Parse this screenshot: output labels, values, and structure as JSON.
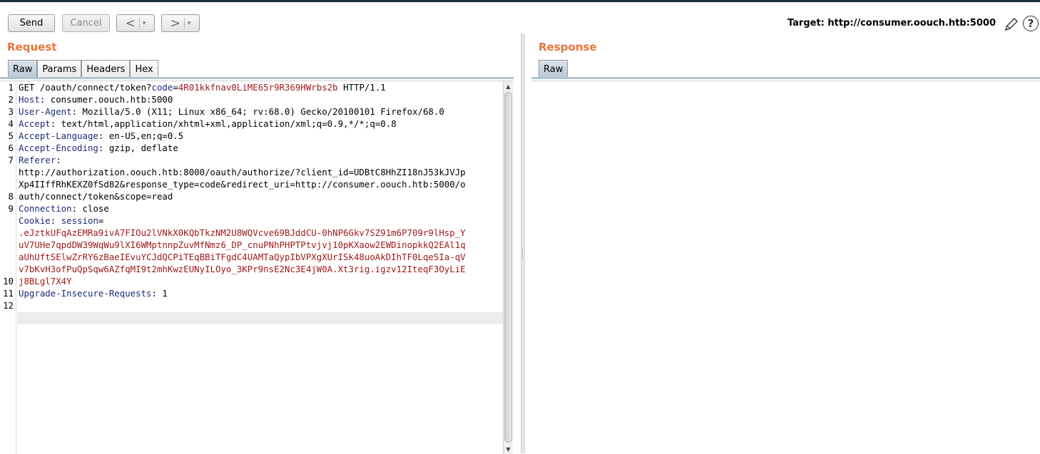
{
  "toolbar": {
    "send_label": "Send",
    "cancel_label": "Cancel",
    "back_glyph": "<",
    "forward_glyph": ">",
    "dropdown_glyph": "▾",
    "target_label": "Target: http://consumer.oouch.htb:5000"
  },
  "request": {
    "title": "Request",
    "tabs": [
      "Raw",
      "Params",
      "Headers",
      "Hex"
    ],
    "active_tab": "Raw",
    "line_numbers": [
      "1",
      "2",
      "3",
      "4",
      "5",
      "6",
      "7",
      "",
      "",
      "8",
      "9",
      "",
      "",
      "",
      "",
      "",
      "10",
      "11",
      "12"
    ],
    "lines": [
      [
        {
          "t": "GET /oauth/connect/token?",
          "c": "v"
        },
        {
          "t": "code",
          "c": "k"
        },
        {
          "t": "=",
          "c": "v"
        },
        {
          "t": "4R01kkfnav0LiME65r9R369HWrbs2b",
          "c": "r"
        },
        {
          "t": " HTTP/1.1",
          "c": "v"
        }
      ],
      [
        {
          "t": "Host",
          "c": "k"
        },
        {
          "t": ": consumer.oouch.htb:5000",
          "c": "v"
        }
      ],
      [
        {
          "t": "User-Agent",
          "c": "k"
        },
        {
          "t": ": Mozilla/5.0 (X11; Linux x86_64; rv:68.0) Gecko/20100101 Firefox/68.0",
          "c": "v"
        }
      ],
      [
        {
          "t": "Accept",
          "c": "k"
        },
        {
          "t": ": text/html,application/xhtml+xml,application/xml;q=0.9,*/*;q=0.8",
          "c": "v"
        }
      ],
      [
        {
          "t": "Accept-Language",
          "c": "k"
        },
        {
          "t": ": en-US,en;q=0.5",
          "c": "v"
        }
      ],
      [
        {
          "t": "Accept-Encoding",
          "c": "k"
        },
        {
          "t": ": gzip, deflate",
          "c": "v"
        }
      ],
      [
        {
          "t": "Referer",
          "c": "k"
        },
        {
          "t": ":",
          "c": "v"
        }
      ],
      [
        {
          "t": "http://authorization.oouch.htb:8000/oauth/authorize/?client_id=UDBtC8HhZI18nJ53kJVJp",
          "c": "v"
        }
      ],
      [
        {
          "t": "Xp4IIffRhKEXZ0fSd82&response_type=code&redirect_uri=http://consumer.oouch.htb:5000/o",
          "c": "v"
        }
      ],
      [
        {
          "t": "auth/connect/token&scope=read",
          "c": "v"
        }
      ],
      [
        {
          "t": "Connection",
          "c": "k"
        },
        {
          "t": ": close",
          "c": "v"
        }
      ],
      [
        {
          "t": "Cookie",
          "c": "k"
        },
        {
          "t": ": ",
          "c": "v"
        },
        {
          "t": "session",
          "c": "k"
        },
        {
          "t": "=",
          "c": "v"
        }
      ],
      [
        {
          "t": ".eJztkUFqAzEMRa9ivA7FIOu2lVNkX0KQbTkzNM2U8WQVcve69BJddCU-0hNP6Gkv7SZ91m6P709r9lHsp_Y",
          "c": "r"
        }
      ],
      [
        {
          "t": "uV7UHe7qpdDW39WqWu9lXI6WMptnnpZuvMfNmz6_DP_cnuPNhPHPTPtvjvj10pKXaow2EWDinopkkQ2EAl1q",
          "c": "r"
        }
      ],
      [
        {
          "t": "aUhUftSElwZrRY6zBaeIEvuYCJdQCPiTEqBBiTFgdC4UAMTaQypIbVPXgXUrISk48uoAkDIhTF0LqeSIa-qV",
          "c": "r"
        }
      ],
      [
        {
          "t": "v7bKvH3ofPuQpSqw6AZfqMI9t2mhKwzEUNyILOyo_3KPr9nsE2Nc3E4jW0A.Xt3rig.igzv12IteqF3OyLiE",
          "c": "r"
        }
      ],
      [
        {
          "t": "j8BLgl7X4Y",
          "c": "r"
        }
      ],
      [
        {
          "t": "Upgrade-Insecure-Requests",
          "c": "k"
        },
        {
          "t": ": 1",
          "c": "v"
        }
      ],
      [],
      []
    ]
  },
  "response": {
    "title": "Response",
    "tabs": [
      "Raw"
    ],
    "active_tab": "Raw"
  },
  "colors": {
    "accent": "#e8743b",
    "header_key": "#1e2a78",
    "param_value": "#a01a1a"
  }
}
